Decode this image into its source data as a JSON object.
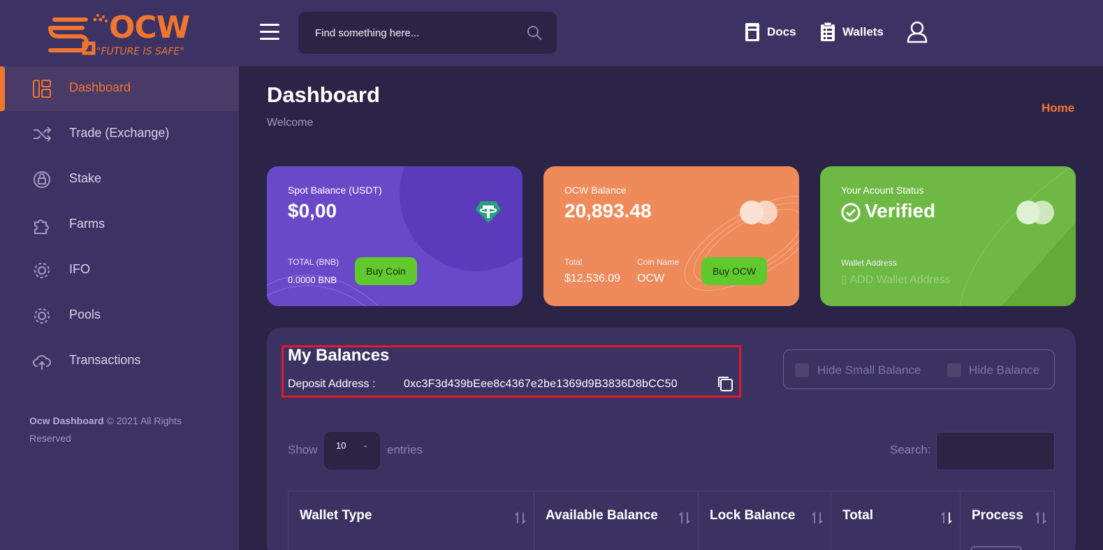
{
  "brand": {
    "name": "OCW",
    "tagline": "\"FUTURE IS SAFE\"",
    "color": "#f0762f"
  },
  "header": {
    "search_placeholder": "Find something here...",
    "links": [
      {
        "label": "Docs",
        "icon": "docs-icon"
      },
      {
        "label": "Wallets",
        "icon": "clipboard-icon"
      }
    ],
    "user_icon": "user-icon"
  },
  "sidebar": {
    "items": [
      {
        "label": "Dashboard",
        "icon": "dashboard-icon",
        "active": true
      },
      {
        "label": "Trade (Exchange)",
        "icon": "shuffle-icon"
      },
      {
        "label": "Stake",
        "icon": "stake-icon"
      },
      {
        "label": "Farms",
        "icon": "puzzle-icon"
      },
      {
        "label": "IFO",
        "icon": "gear-icon"
      },
      {
        "label": "Pools",
        "icon": "gear-icon"
      },
      {
        "label": "Transactions",
        "icon": "cloud-upload-icon"
      }
    ],
    "footer_brand": "Ocw Dashboard",
    "footer_text": " © 2021 All Rights Reserved"
  },
  "page": {
    "title": "Dashboard",
    "subtitle": "Welcome",
    "breadcrumb": "Home"
  },
  "cards": {
    "spot": {
      "label": "Spot Balance (USDT)",
      "value": "$0,00",
      "total_label": "TOTAL (BNB)",
      "total_value": "0.0000 BNB",
      "button": "Buy Coin",
      "icon": "tether-icon"
    },
    "ocw": {
      "label": "OCW Balance",
      "value": "20,893.48",
      "total_label": "Total",
      "total_value": "$12,536.09",
      "coin_label": "Coin Name",
      "coin_value": "OCW",
      "button": "Buy OCW",
      "icon": "mastercard-icon"
    },
    "status": {
      "label": "Your Acount Status",
      "value": "Verified",
      "wallet_label": "Wallet Address",
      "wallet_placeholder": "ADD Wallet Address",
      "icon": "mastercard-icon"
    }
  },
  "balances": {
    "title": "My Balances",
    "deposit_label": "Deposit Address :",
    "deposit_address": "0xc3F3d439bEee8c4367e2be1369d9B3836D8bCC50",
    "hide_small": "Hide Small Balance",
    "hide_balance": "Hide Balance",
    "show_label": "Show",
    "entries_value": "10",
    "entries_label": "entries",
    "search_label": "Search:",
    "columns": [
      "Wallet Type",
      "Available Balance",
      "Lock Balance",
      "Total",
      "Process"
    ]
  }
}
